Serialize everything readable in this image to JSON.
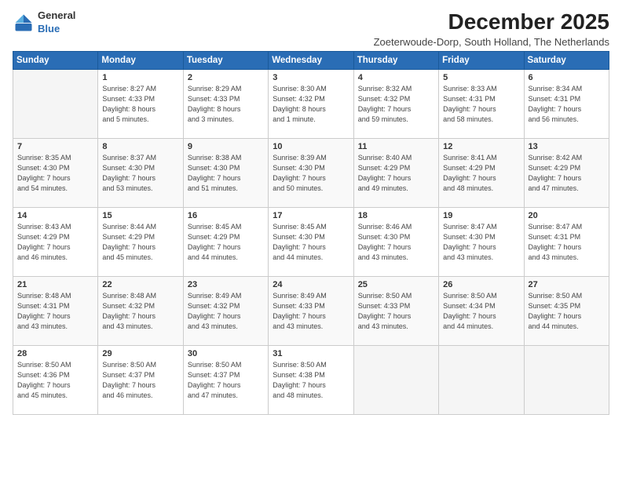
{
  "logo": {
    "line1": "General",
    "line2": "Blue"
  },
  "title": "December 2025",
  "subtitle": "Zoeterwoude-Dorp, South Holland, The Netherlands",
  "days_of_week": [
    "Sunday",
    "Monday",
    "Tuesday",
    "Wednesday",
    "Thursday",
    "Friday",
    "Saturday"
  ],
  "weeks": [
    [
      {
        "day": "",
        "detail": ""
      },
      {
        "day": "1",
        "detail": "Sunrise: 8:27 AM\nSunset: 4:33 PM\nDaylight: 8 hours\nand 5 minutes."
      },
      {
        "day": "2",
        "detail": "Sunrise: 8:29 AM\nSunset: 4:33 PM\nDaylight: 8 hours\nand 3 minutes."
      },
      {
        "day": "3",
        "detail": "Sunrise: 8:30 AM\nSunset: 4:32 PM\nDaylight: 8 hours\nand 1 minute."
      },
      {
        "day": "4",
        "detail": "Sunrise: 8:32 AM\nSunset: 4:32 PM\nDaylight: 7 hours\nand 59 minutes."
      },
      {
        "day": "5",
        "detail": "Sunrise: 8:33 AM\nSunset: 4:31 PM\nDaylight: 7 hours\nand 58 minutes."
      },
      {
        "day": "6",
        "detail": "Sunrise: 8:34 AM\nSunset: 4:31 PM\nDaylight: 7 hours\nand 56 minutes."
      }
    ],
    [
      {
        "day": "7",
        "detail": "Sunrise: 8:35 AM\nSunset: 4:30 PM\nDaylight: 7 hours\nand 54 minutes."
      },
      {
        "day": "8",
        "detail": "Sunrise: 8:37 AM\nSunset: 4:30 PM\nDaylight: 7 hours\nand 53 minutes."
      },
      {
        "day": "9",
        "detail": "Sunrise: 8:38 AM\nSunset: 4:30 PM\nDaylight: 7 hours\nand 51 minutes."
      },
      {
        "day": "10",
        "detail": "Sunrise: 8:39 AM\nSunset: 4:30 PM\nDaylight: 7 hours\nand 50 minutes."
      },
      {
        "day": "11",
        "detail": "Sunrise: 8:40 AM\nSunset: 4:29 PM\nDaylight: 7 hours\nand 49 minutes."
      },
      {
        "day": "12",
        "detail": "Sunrise: 8:41 AM\nSunset: 4:29 PM\nDaylight: 7 hours\nand 48 minutes."
      },
      {
        "day": "13",
        "detail": "Sunrise: 8:42 AM\nSunset: 4:29 PM\nDaylight: 7 hours\nand 47 minutes."
      }
    ],
    [
      {
        "day": "14",
        "detail": "Sunrise: 8:43 AM\nSunset: 4:29 PM\nDaylight: 7 hours\nand 46 minutes."
      },
      {
        "day": "15",
        "detail": "Sunrise: 8:44 AM\nSunset: 4:29 PM\nDaylight: 7 hours\nand 45 minutes."
      },
      {
        "day": "16",
        "detail": "Sunrise: 8:45 AM\nSunset: 4:29 PM\nDaylight: 7 hours\nand 44 minutes."
      },
      {
        "day": "17",
        "detail": "Sunrise: 8:45 AM\nSunset: 4:30 PM\nDaylight: 7 hours\nand 44 minutes."
      },
      {
        "day": "18",
        "detail": "Sunrise: 8:46 AM\nSunset: 4:30 PM\nDaylight: 7 hours\nand 43 minutes."
      },
      {
        "day": "19",
        "detail": "Sunrise: 8:47 AM\nSunset: 4:30 PM\nDaylight: 7 hours\nand 43 minutes."
      },
      {
        "day": "20",
        "detail": "Sunrise: 8:47 AM\nSunset: 4:31 PM\nDaylight: 7 hours\nand 43 minutes."
      }
    ],
    [
      {
        "day": "21",
        "detail": "Sunrise: 8:48 AM\nSunset: 4:31 PM\nDaylight: 7 hours\nand 43 minutes."
      },
      {
        "day": "22",
        "detail": "Sunrise: 8:48 AM\nSunset: 4:32 PM\nDaylight: 7 hours\nand 43 minutes."
      },
      {
        "day": "23",
        "detail": "Sunrise: 8:49 AM\nSunset: 4:32 PM\nDaylight: 7 hours\nand 43 minutes."
      },
      {
        "day": "24",
        "detail": "Sunrise: 8:49 AM\nSunset: 4:33 PM\nDaylight: 7 hours\nand 43 minutes."
      },
      {
        "day": "25",
        "detail": "Sunrise: 8:50 AM\nSunset: 4:33 PM\nDaylight: 7 hours\nand 43 minutes."
      },
      {
        "day": "26",
        "detail": "Sunrise: 8:50 AM\nSunset: 4:34 PM\nDaylight: 7 hours\nand 44 minutes."
      },
      {
        "day": "27",
        "detail": "Sunrise: 8:50 AM\nSunset: 4:35 PM\nDaylight: 7 hours\nand 44 minutes."
      }
    ],
    [
      {
        "day": "28",
        "detail": "Sunrise: 8:50 AM\nSunset: 4:36 PM\nDaylight: 7 hours\nand 45 minutes."
      },
      {
        "day": "29",
        "detail": "Sunrise: 8:50 AM\nSunset: 4:37 PM\nDaylight: 7 hours\nand 46 minutes."
      },
      {
        "day": "30",
        "detail": "Sunrise: 8:50 AM\nSunset: 4:37 PM\nDaylight: 7 hours\nand 47 minutes."
      },
      {
        "day": "31",
        "detail": "Sunrise: 8:50 AM\nSunset: 4:38 PM\nDaylight: 7 hours\nand 48 minutes."
      },
      {
        "day": "",
        "detail": ""
      },
      {
        "day": "",
        "detail": ""
      },
      {
        "day": "",
        "detail": ""
      }
    ]
  ]
}
